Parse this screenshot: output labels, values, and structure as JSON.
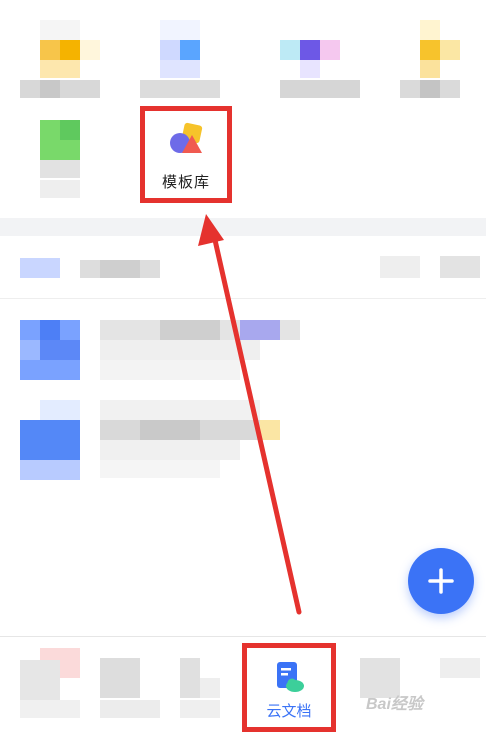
{
  "templates": {
    "label": "模板库"
  },
  "tabbar": {
    "cloud_docs_label": "云文档"
  },
  "fab": {
    "label": "+"
  },
  "watermark": {
    "text": "Bai经验"
  },
  "colors": {
    "accent": "#3b73f6",
    "highlight": "#e5322e"
  }
}
